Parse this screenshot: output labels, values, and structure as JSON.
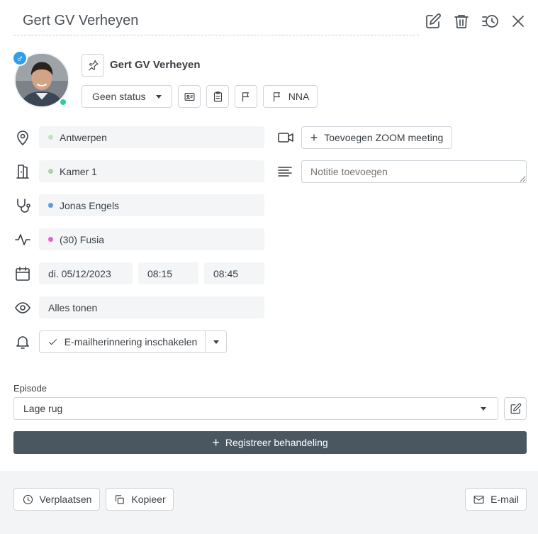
{
  "header": {
    "title": "Gert GV Verheyen"
  },
  "patient": {
    "name": "Gert GV Verheyen",
    "gender_symbol": "♂",
    "status_label": "Geen status",
    "flag_label": "NNA"
  },
  "fields": {
    "location": "Antwerpen",
    "room": "Kamer 1",
    "practitioner": "Jonas Engels",
    "service": "(30) Fusia",
    "date": "di. 05/12/2023",
    "time_start": "08:15",
    "time_end": "08:45",
    "visibility": "Alles tonen",
    "reminder_label": "E-mailherinnering inschakelen"
  },
  "zoom": {
    "label": "Toevoegen ZOOM meeting"
  },
  "note": {
    "placeholder": "Notitie toevoegen"
  },
  "episode": {
    "label": "Episode",
    "value": "Lage rug"
  },
  "register": {
    "label": "Registreer behandeling"
  },
  "footer": {
    "move_label": "Verplaatsen",
    "copy_label": "Kopieer",
    "email_label": "E-mail"
  },
  "colors": {
    "location_dot": "#b7dcb7",
    "room_dot": "#a8d5a0",
    "practitioner_dot": "#5b9be8",
    "service_dot": "#f25ad6",
    "register_bg": "#4a5660",
    "gender_badge": "#2f9fe8",
    "online": "#2ecc9a"
  },
  "icons": {
    "edit": "edit-icon",
    "delete": "trash-icon",
    "history": "history-icon",
    "close": "close-icon",
    "pin": "pin-icon",
    "id_card": "id-card-icon",
    "clipboard": "clipboard-icon",
    "flag": "flag-icon",
    "location": "map-pin-icon",
    "door": "door-icon",
    "stethoscope": "stethoscope-icon",
    "activity": "activity-icon",
    "calendar": "calendar-icon",
    "eye": "eye-icon",
    "bell": "bell-icon",
    "video": "video-icon",
    "notes": "align-left-icon",
    "check": "check-icon",
    "move": "clock-icon",
    "copy": "copy-icon",
    "mail": "mail-icon"
  }
}
